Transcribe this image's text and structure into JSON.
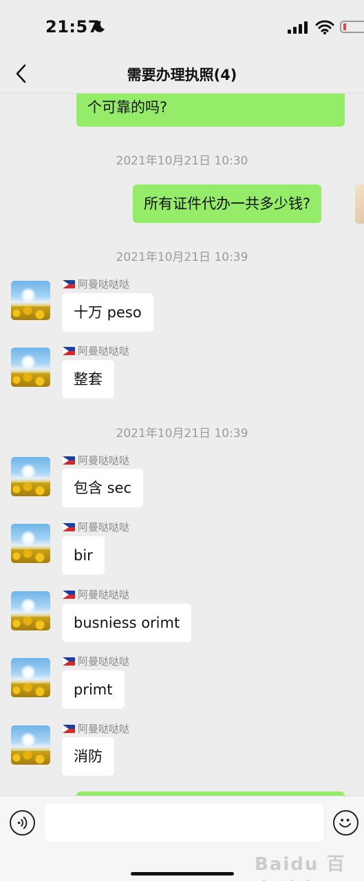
{
  "status_bar": {
    "time": "21:57"
  },
  "header": {
    "title": "需要办理执照(4)"
  },
  "messages": {
    "m0": {
      "text": "个可靠的吗?"
    },
    "t1": {
      "text": "2021年10月21日 10:30"
    },
    "m1": {
      "text": "所有证件代办一共多少钱?"
    },
    "t2": {
      "text": "2021年10月21日 10:39"
    },
    "m2": {
      "sender": "阿曼哒哒哒",
      "text": "十万 peso"
    },
    "m3": {
      "sender": "阿曼哒哒哒",
      "text": "整套"
    },
    "t3": {
      "text": "2021年10月21日 10:39"
    },
    "m4": {
      "sender": "阿曼哒哒哒",
      "text": "包含 sec"
    },
    "m5": {
      "sender": "阿曼哒哒哒",
      "text": "bir"
    },
    "m6": {
      "sender": "阿曼哒哒哒",
      "text": "busniess orimt"
    },
    "m7": {
      "sender": "阿曼哒哒哒",
      "text": "primt"
    },
    "m8": {
      "sender": "阿曼哒哒哒",
      "text": "消防"
    }
  },
  "input_bar": {
    "placeholder": "",
    "watermark": "Baidu 百度 头条"
  },
  "colors": {
    "my_bubble": "#95ec69",
    "their_bubble": "#ffffff",
    "background": "#ededed"
  },
  "icons": [
    "back-icon",
    "voice-icon",
    "emoji-icon",
    "moon-icon",
    "wifi-icon",
    "signal-icon",
    "battery-icon"
  ]
}
